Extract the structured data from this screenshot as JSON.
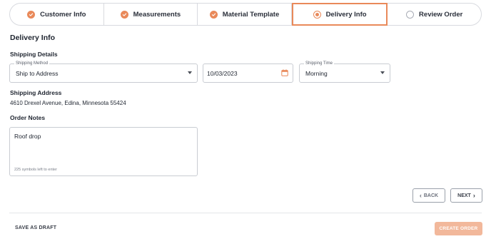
{
  "stepper": {
    "steps": [
      {
        "label": "Customer Info",
        "state": "done"
      },
      {
        "label": "Measurements",
        "state": "done"
      },
      {
        "label": "Material Template",
        "state": "done"
      },
      {
        "label": "Delivery Info",
        "state": "active"
      },
      {
        "label": "Review Order",
        "state": "pending"
      }
    ]
  },
  "section": {
    "title": "Delivery Info",
    "shipping_details_heading": "Shipping Details",
    "shipping_address_heading": "Shipping Address",
    "order_notes_heading": "Order Notes"
  },
  "shipping": {
    "method_label": "Shipping Method",
    "method_value": "Ship to Address",
    "date_value": "10/03/2023",
    "time_label": "Shipping Time",
    "time_value": "Morning",
    "address": "4610 Drexel Avenue, Edina, Minnesota 55424"
  },
  "notes": {
    "value": "Roof drop",
    "counter": "225 symbols left to enter"
  },
  "nav": {
    "back_label": "BACK",
    "next_label": "NEXT"
  },
  "footer": {
    "save_draft_label": "SAVE AS DRAFT",
    "create_order_label": "CREATE ORDER"
  },
  "colors": {
    "accent": "#e9895a",
    "create_disabled": "#f2b89b"
  }
}
